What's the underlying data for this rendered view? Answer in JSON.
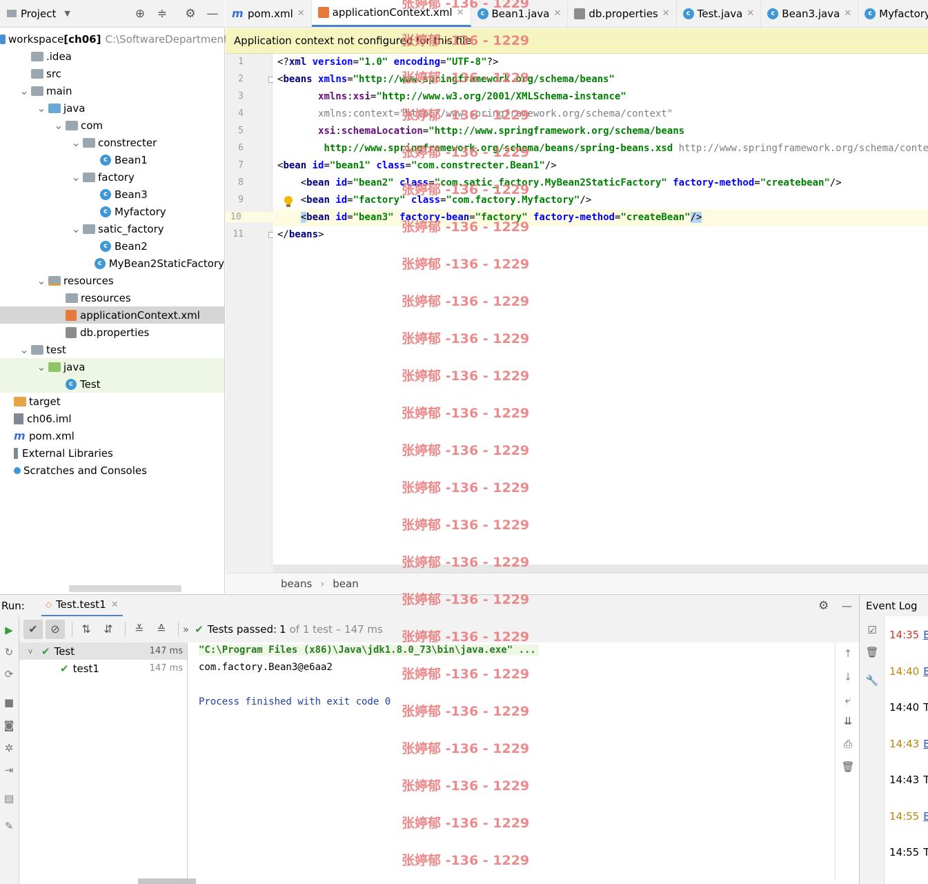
{
  "project_panel": {
    "title": "Project",
    "tree": [
      {
        "label": "workspace",
        "bold": "[ch06]",
        "path": "C:\\SoftwareDepartment\\",
        "indent": 0,
        "icon": "module",
        "twisty": ""
      },
      {
        "label": ".idea",
        "indent": 1,
        "icon": "folder-grey",
        "twisty": ""
      },
      {
        "label": "src",
        "indent": 1,
        "icon": "folder-grey",
        "twisty": ""
      },
      {
        "label": "main",
        "indent": 1,
        "icon": "folder-grey",
        "twisty": "v"
      },
      {
        "label": "java",
        "indent": 2,
        "icon": "folder-blue",
        "twisty": "v"
      },
      {
        "label": "com",
        "indent": 3,
        "icon": "folder-grey",
        "twisty": "v"
      },
      {
        "label": "constrecter",
        "indent": 4,
        "icon": "folder-grey",
        "twisty": "v"
      },
      {
        "label": "Bean1",
        "indent": 5,
        "icon": "class",
        "twisty": ""
      },
      {
        "label": "factory",
        "indent": 4,
        "icon": "folder-grey",
        "twisty": "v"
      },
      {
        "label": "Bean3",
        "indent": 5,
        "icon": "class",
        "twisty": ""
      },
      {
        "label": "Myfactory",
        "indent": 5,
        "icon": "class",
        "twisty": ""
      },
      {
        "label": "satic_factory",
        "indent": 4,
        "icon": "folder-grey",
        "twisty": "v"
      },
      {
        "label": "Bean2",
        "indent": 5,
        "icon": "class",
        "twisty": ""
      },
      {
        "label": "MyBean2StaticFactory",
        "indent": 5,
        "icon": "class",
        "twisty": ""
      },
      {
        "label": "resources",
        "indent": 2,
        "icon": "folder-res",
        "twisty": "v"
      },
      {
        "label": "resources",
        "indent": 3,
        "icon": "folder-grey",
        "twisty": ""
      },
      {
        "label": "applicationContext.xml",
        "indent": 3,
        "icon": "xml",
        "twisty": "",
        "selected": true
      },
      {
        "label": "db.properties",
        "indent": 3,
        "icon": "props",
        "twisty": ""
      },
      {
        "label": "test",
        "indent": 1,
        "icon": "folder-grey",
        "twisty": "v"
      },
      {
        "label": "java",
        "indent": 2,
        "icon": "folder-green",
        "twisty": "v",
        "highlight": true
      },
      {
        "label": "Test",
        "indent": 3,
        "icon": "class-test",
        "twisty": "",
        "highlight": true
      },
      {
        "label": "target",
        "indent": 0,
        "icon": "folder-orange",
        "twisty": ""
      },
      {
        "label": "ch06.iml",
        "indent": 0,
        "icon": "iml",
        "twisty": ""
      },
      {
        "label": "pom.xml",
        "indent": 0,
        "icon": "maven",
        "twisty": ""
      },
      {
        "label": "External Libraries",
        "indent": 0,
        "icon": "lib",
        "twisty": ""
      },
      {
        "label": "Scratches and Consoles",
        "indent": 0,
        "icon": "scratch",
        "twisty": ""
      }
    ]
  },
  "tabs": [
    {
      "label": "pom.xml",
      "icon": "maven",
      "active": false
    },
    {
      "label": "applicationContext.xml",
      "icon": "xml",
      "active": true
    },
    {
      "label": "Bean1.java",
      "icon": "class",
      "active": false
    },
    {
      "label": "db.properties",
      "icon": "props",
      "active": false
    },
    {
      "label": "Test.java",
      "icon": "class-test",
      "active": false
    },
    {
      "label": "Bean3.java",
      "icon": "class",
      "active": false
    },
    {
      "label": "Myfactory.j",
      "icon": "class",
      "active": false
    }
  ],
  "notification": "Application context not configured for this file",
  "editor": {
    "line_numbers": [
      "1",
      "2",
      "3",
      "4",
      "5",
      "6",
      "7",
      "8",
      "9",
      "10",
      "11"
    ],
    "current_line": 10
  },
  "breadcrumb": [
    "beans",
    "bean"
  ],
  "run": {
    "label": "Run:",
    "config_tab": "Test.test1",
    "status_prefix": "Tests passed:",
    "status_count": "1",
    "status_suffix": "of 1 test – 147 ms",
    "tests": [
      {
        "name": "Test",
        "time": "147 ms",
        "level": 0
      },
      {
        "name": "test1",
        "time": "147 ms",
        "level": 1
      }
    ],
    "console": [
      "\"C:\\Program Files (x86)\\Java\\jdk1.8.0_73\\bin\\java.exe\" ...",
      "com.factory.Bean3@e6aa2",
      "",
      "Process finished with exit code 0"
    ]
  },
  "event_log": {
    "title": "Event Log",
    "entries": [
      {
        "time": "14:35",
        "text": "B",
        "color": "#c0392b",
        "link": true
      },
      {
        "time": "14:40",
        "text": "B",
        "color": "#b7860b",
        "link": true
      },
      {
        "time": "14:40",
        "text": "T",
        "color": "#000000",
        "link": false
      },
      {
        "time": "14:43",
        "text": "B",
        "color": "#b7860b",
        "link": true
      },
      {
        "time": "14:43",
        "text": "T",
        "color": "#000000",
        "link": false
      },
      {
        "time": "14:55",
        "text": "B",
        "color": "#b7860b",
        "link": true
      },
      {
        "time": "14:55",
        "text": "T",
        "color": "#000000",
        "link": false
      }
    ]
  },
  "watermark": "张婷郁 -136 - 1229",
  "colors": {
    "accent": "#4b83cf",
    "notification_bg": "#f6f4bf",
    "pass_green": "#3c9a3c",
    "watermark": "#e97777"
  }
}
